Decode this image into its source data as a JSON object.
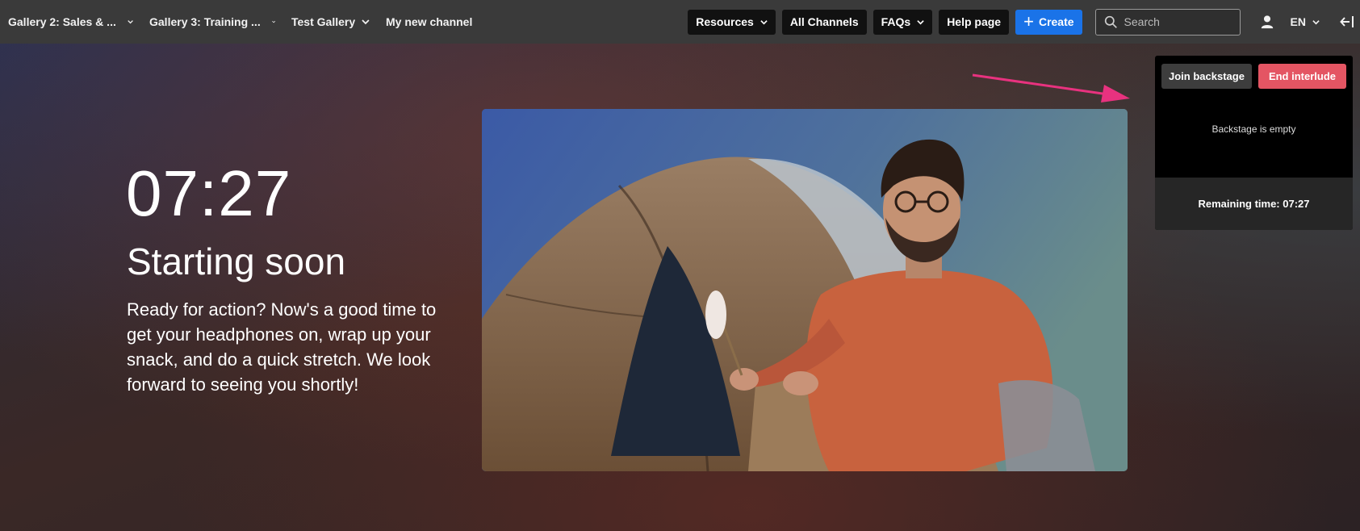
{
  "nav": {
    "items": [
      {
        "label": "Gallery 2: Sales & ...",
        "has_dropdown": true
      },
      {
        "label": "Gallery 3: Training ...",
        "has_dropdown": true
      },
      {
        "label": "Test Gallery",
        "has_dropdown": true
      },
      {
        "label": "My new channel",
        "has_dropdown": false
      }
    ],
    "resources_label": "Resources",
    "all_channels_label": "All Channels",
    "faqs_label": "FAQs",
    "help_label": "Help page",
    "create_label": "Create",
    "search_placeholder": "Search",
    "language": "EN",
    "icons": {
      "search": "search-icon",
      "user": "user-icon",
      "chevron": "chevron-down-icon",
      "collapse": "collapse-sidebar-icon",
      "plus": "plus-icon"
    },
    "colors": {
      "create": "#1a73e8",
      "bar": "#3a3a3a"
    }
  },
  "interlude": {
    "countdown": "07:27",
    "headline": "Starting soon",
    "blurb": "Ready for action? Now's a good time to get your headphones on, wrap up your snack, and do a quick stretch. We look forward to seeing you shortly!"
  },
  "backstage": {
    "join_label": "Join backstage",
    "end_label": "End interlude",
    "empty_text": "Backstage is empty",
    "remaining_label": "Remaining time: 07:27",
    "colors": {
      "end": "#e45563",
      "arrow": "#e8327f"
    }
  }
}
